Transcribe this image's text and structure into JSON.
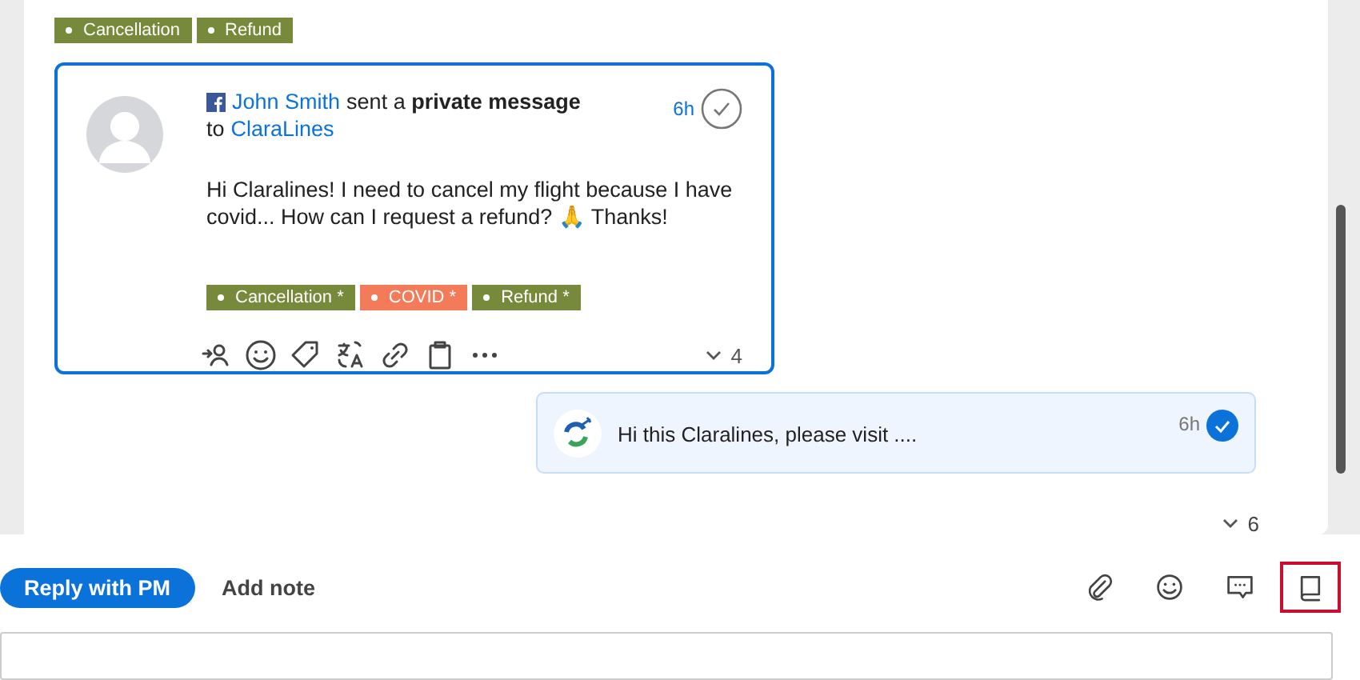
{
  "thread_tags": [
    {
      "label": "Cancellation",
      "color": "#77893a"
    },
    {
      "label": "Refund",
      "color": "#77893a"
    }
  ],
  "message": {
    "sender": "John Smith",
    "action": "sent a **private message**",
    "to_prefix": "to",
    "recipient": "ClaraLines",
    "time": "6h",
    "resolved": false,
    "body": "Hi Claralines! I need to cancel my flight because I have covid... How can I request a refund? 🙏 Thanks!",
    "tags": [
      {
        "label": "Cancellation *",
        "color": "#77893a"
      },
      {
        "label": "COVID *",
        "color": "#f47b5a"
      },
      {
        "label": "Refund *",
        "color": "#77893a"
      }
    ],
    "reply_count": "4"
  },
  "reply": {
    "text": "Hi this Claralines, please visit ....",
    "time": "6h",
    "sent": true
  },
  "thread_count": "6",
  "composer": {
    "modes": [
      {
        "label": "Reply with PM",
        "selected": true
      },
      {
        "label": "Add note",
        "selected": false
      }
    ],
    "tools": [
      {
        "kind": "attach",
        "highlighted": false
      },
      {
        "kind": "emoji",
        "highlighted": false
      },
      {
        "kind": "comment",
        "highlighted": false
      },
      {
        "kind": "book",
        "highlighted": true
      }
    ]
  }
}
